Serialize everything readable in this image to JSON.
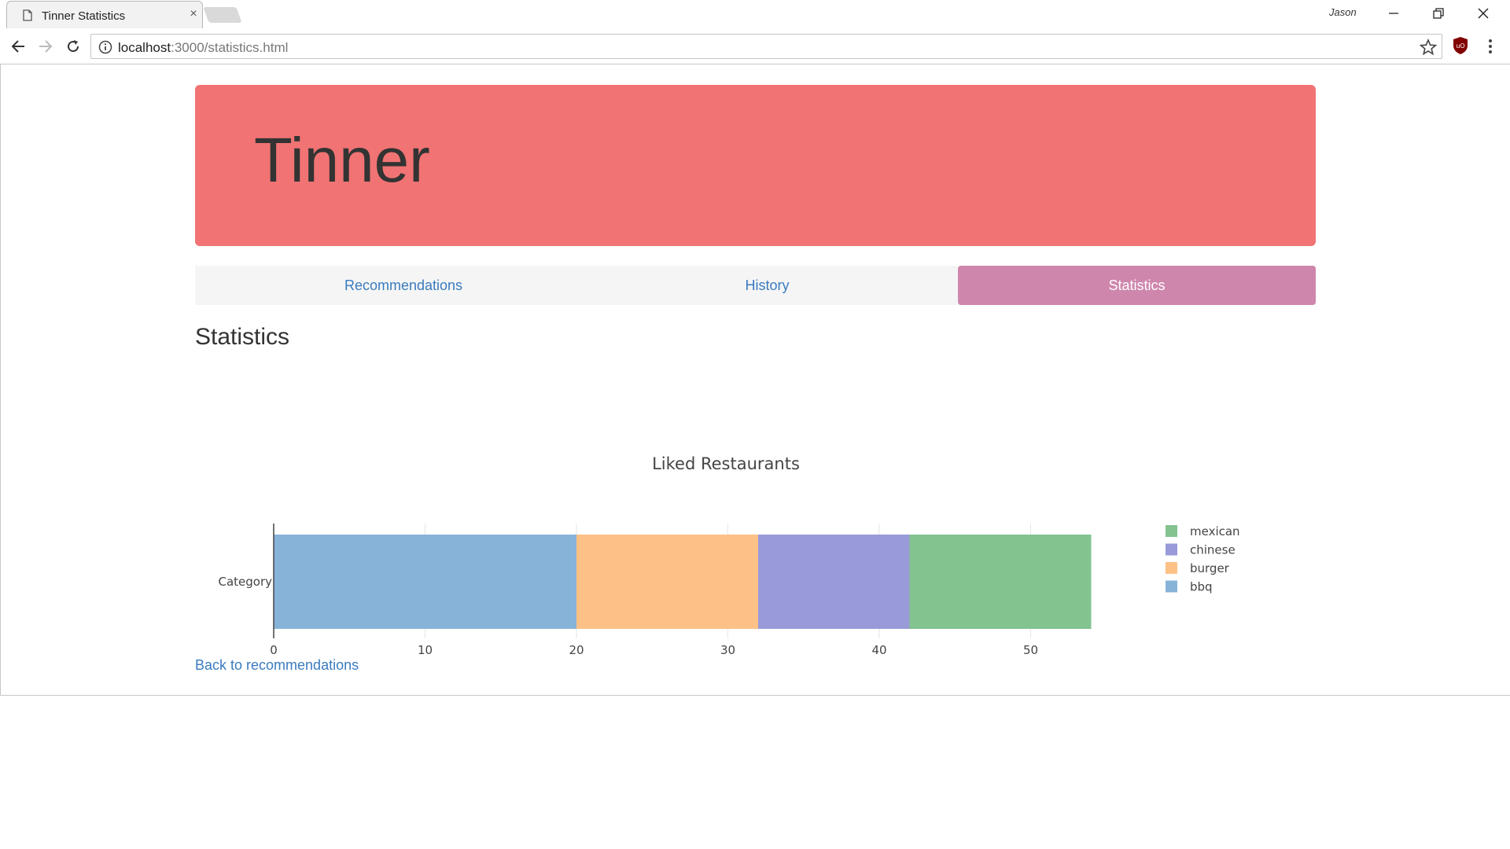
{
  "browser": {
    "tab_title": "Tinner Statistics",
    "tab_close": "×",
    "profile_name": "Jason",
    "url_host": "localhost",
    "url_path": ":3000/statistics.html",
    "extension_label": "uO"
  },
  "page": {
    "brand": "Tinner",
    "nav": [
      {
        "label": "Recommendations",
        "active": false
      },
      {
        "label": "History",
        "active": false
      },
      {
        "label": "Statistics",
        "active": true
      }
    ],
    "heading": "Statistics",
    "back_link": "Back to recommendations"
  },
  "chart_data": {
    "type": "bar",
    "orientation": "horizontal",
    "stacked": true,
    "title": "Liked Restaurants",
    "categories": [
      "Category"
    ],
    "series": [
      {
        "name": "bbq",
        "values": [
          20
        ],
        "color": "#88b3d9"
      },
      {
        "name": "burger",
        "values": [
          12
        ],
        "color": "#fdc187"
      },
      {
        "name": "chinese",
        "values": [
          10
        ],
        "color": "#989bd8"
      },
      {
        "name": "mexican",
        "values": [
          12
        ],
        "color": "#82c390"
      }
    ],
    "legend_order": [
      "mexican",
      "chinese",
      "burger",
      "bbq"
    ],
    "x_ticks": [
      0,
      10,
      20,
      30,
      40,
      50
    ],
    "xlim": [
      0,
      54
    ],
    "grid": true,
    "legend_position": "right"
  }
}
